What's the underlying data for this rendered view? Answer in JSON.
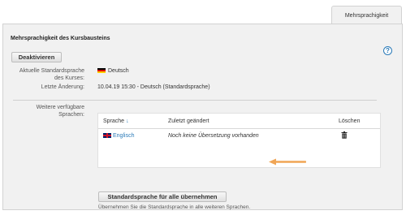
{
  "tabs": [
    {
      "label": "Mehrsprachigkeit",
      "active": true
    }
  ],
  "panel": {
    "title": "Mehrsprachigkeit des Kursbausteins",
    "help_icon": "question-circle-icon",
    "deactivate_label": "Deaktivieren"
  },
  "info": {
    "current_lang_label_1": "Aktuelle Standardsprache",
    "current_lang_label_2": "des Kurses:",
    "current_lang_value": "Deutsch",
    "last_change_label": "Letzte Änderung:",
    "last_change_value": "10.04.19 15:30 - Deutsch (Standardsprache)"
  },
  "other_langs": {
    "label_1": "Weitere verfügbare",
    "label_2": "Sprachen:",
    "columns": [
      "Sprache",
      "Zuletzt geändert",
      "Löschen"
    ],
    "sort_indicator": "↓",
    "rows": [
      {
        "language": "Englisch",
        "last_changed": "Noch keine Übersetzung vorhanden",
        "flag": "gb-flag-icon"
      }
    ]
  },
  "actions": {
    "apply_default_label": "Standardsprache für alle übernehmen",
    "apply_default_hint": "Übernehmen Sie die Standardsprache in alle weiteren Sprachen."
  },
  "colors": {
    "accent": "#2a7ab8",
    "arrow": "#f0a555",
    "panel_bg": "#f1f1f1"
  }
}
